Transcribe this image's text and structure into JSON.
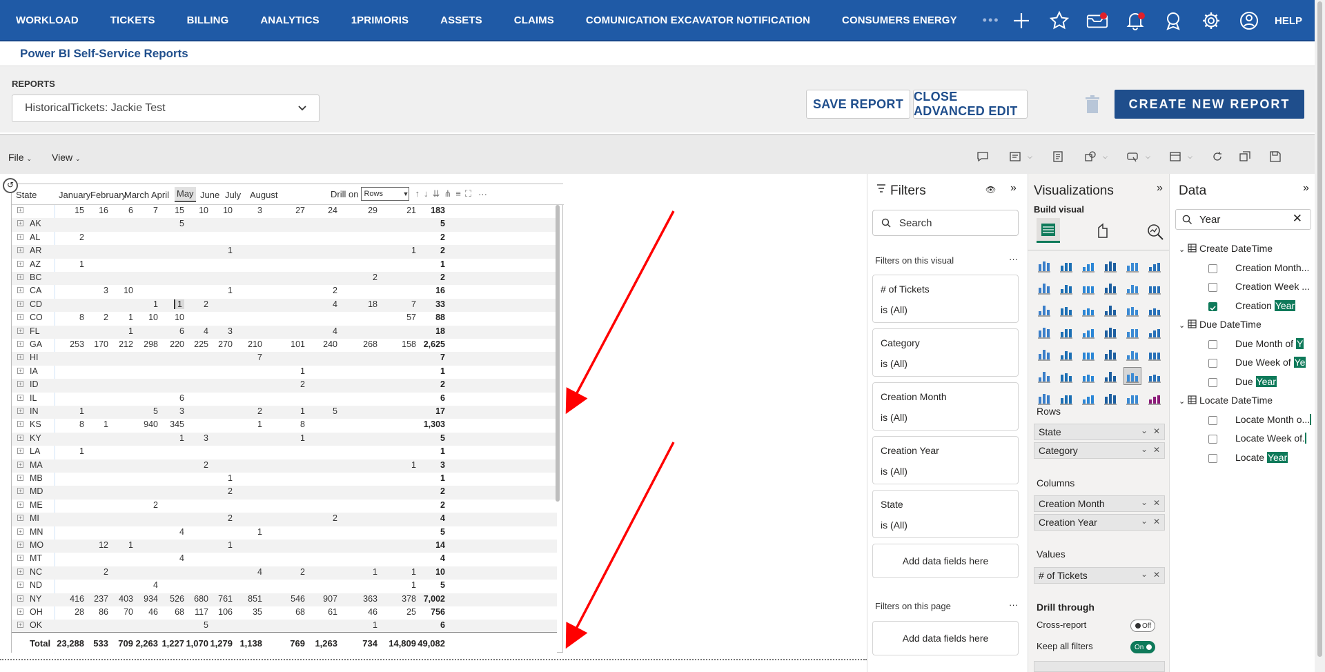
{
  "nav": {
    "items": [
      "WORKLOAD",
      "TICKETS",
      "BILLING",
      "ANALYTICS",
      "1PRIMORIS",
      "ASSETS",
      "CLAIMS",
      "COMUNICATION EXCAVATOR NOTIFICATION",
      "CONSUMERS ENERGY"
    ],
    "more": "•••",
    "help": "HELP"
  },
  "page": {
    "title": "Power BI Self-Service Reports",
    "reports_label": "REPORTS",
    "report_selected": "HistoricalTickets: Jackie Test",
    "save_label": "SAVE REPORT",
    "close_edit_label": "CLOSE ADVANCED EDIT",
    "create_label": "CREATE NEW REPORT"
  },
  "toolbar": {
    "file": "File",
    "view": "View"
  },
  "matrix": {
    "state_header": "State",
    "months": [
      "January",
      "February",
      "March",
      "April",
      "May",
      "June",
      "July",
      "August"
    ],
    "selected_month": "May",
    "drill_label": "Drill on",
    "drill_value": "Rows",
    "rows": [
      {
        "state": "",
        "v": [
          "15",
          "16",
          "6",
          "7",
          "15",
          "10",
          "10",
          "3",
          "27",
          "24",
          "29",
          "21"
        ],
        "t": "183"
      },
      {
        "state": "AK",
        "v": [
          "",
          "",
          "",
          "",
          "5",
          "",
          "",
          "",
          "",
          "",
          "",
          ""
        ],
        "t": "5"
      },
      {
        "state": "AL",
        "v": [
          "2",
          "",
          "",
          "",
          "",
          "",
          "",
          "",
          "",
          "",
          "",
          ""
        ],
        "t": "2"
      },
      {
        "state": "AR",
        "v": [
          "",
          "",
          "",
          "",
          "",
          "",
          "1",
          "",
          "",
          "",
          "",
          "1"
        ],
        "t": "2"
      },
      {
        "state": "AZ",
        "v": [
          "1",
          "",
          "",
          "",
          "",
          "",
          "",
          "",
          "",
          "",
          "",
          ""
        ],
        "t": "1"
      },
      {
        "state": "BC",
        "v": [
          "",
          "",
          "",
          "",
          "",
          "",
          "",
          "",
          "",
          "",
          "2",
          ""
        ],
        "t": "2"
      },
      {
        "state": "CA",
        "v": [
          "",
          "3",
          "10",
          "",
          "",
          "",
          "1",
          "",
          "",
          "2",
          "",
          ""
        ],
        "t": "16"
      },
      {
        "state": "CD",
        "v": [
          "",
          "",
          "",
          "1",
          "1",
          "2",
          "",
          "",
          "",
          "4",
          "18",
          "7"
        ],
        "t": "33"
      },
      {
        "state": "CO",
        "v": [
          "8",
          "2",
          "1",
          "10",
          "10",
          "",
          "",
          "",
          "",
          "",
          "",
          "57"
        ],
        "t": "88"
      },
      {
        "state": "FL",
        "v": [
          "",
          "",
          "1",
          "",
          "6",
          "4",
          "3",
          "",
          "",
          "4",
          "",
          ""
        ],
        "t": "18"
      },
      {
        "state": "GA",
        "v": [
          "253",
          "170",
          "212",
          "298",
          "220",
          "225",
          "270",
          "210",
          "101",
          "240",
          "268",
          "158"
        ],
        "t": "2,625"
      },
      {
        "state": "HI",
        "v": [
          "",
          "",
          "",
          "",
          "",
          "",
          "",
          "7",
          "",
          "",
          "",
          ""
        ],
        "t": "7"
      },
      {
        "state": "IA",
        "v": [
          "",
          "",
          "",
          "",
          "",
          "",
          "",
          "",
          "1",
          "",
          "",
          ""
        ],
        "t": "1"
      },
      {
        "state": "ID",
        "v": [
          "",
          "",
          "",
          "",
          "",
          "",
          "",
          "",
          "2",
          "",
          "",
          ""
        ],
        "t": "2"
      },
      {
        "state": "IL",
        "v": [
          "",
          "",
          "",
          "",
          "6",
          "",
          "",
          "",
          "",
          "",
          "",
          ""
        ],
        "t": "6"
      },
      {
        "state": "IN",
        "v": [
          "1",
          "",
          "",
          "5",
          "3",
          "",
          "",
          "2",
          "1",
          "5",
          "",
          ""
        ],
        "t": "17"
      },
      {
        "state": "KS",
        "v": [
          "8",
          "1",
          "",
          "940",
          "345",
          "",
          "",
          "1",
          "8",
          "",
          "",
          ""
        ],
        "t": "1,303"
      },
      {
        "state": "KY",
        "v": [
          "",
          "",
          "",
          "",
          "1",
          "3",
          "",
          "",
          "1",
          "",
          "",
          ""
        ],
        "t": "5"
      },
      {
        "state": "LA",
        "v": [
          "1",
          "",
          "",
          "",
          "",
          "",
          "",
          "",
          "",
          "",
          "",
          ""
        ],
        "t": "1"
      },
      {
        "state": "MA",
        "v": [
          "",
          "",
          "",
          "",
          "",
          "2",
          "",
          "",
          "",
          "",
          "",
          "1"
        ],
        "t": "3"
      },
      {
        "state": "MB",
        "v": [
          "",
          "",
          "",
          "",
          "",
          "",
          "1",
          "",
          "",
          "",
          "",
          ""
        ],
        "t": "1"
      },
      {
        "state": "MD",
        "v": [
          "",
          "",
          "",
          "",
          "",
          "",
          "2",
          "",
          "",
          "",
          "",
          ""
        ],
        "t": "2"
      },
      {
        "state": "ME",
        "v": [
          "",
          "",
          "",
          "2",
          "",
          "",
          "",
          "",
          "",
          "",
          "",
          ""
        ],
        "t": "2"
      },
      {
        "state": "MI",
        "v": [
          "",
          "",
          "",
          "",
          "",
          "",
          "2",
          "",
          "",
          "2",
          "",
          ""
        ],
        "t": "4"
      },
      {
        "state": "MN",
        "v": [
          "",
          "",
          "",
          "",
          "4",
          "",
          "",
          "1",
          "",
          "",
          "",
          ""
        ],
        "t": "5"
      },
      {
        "state": "MO",
        "v": [
          "",
          "12",
          "1",
          "",
          "",
          "",
          "1",
          "",
          "",
          "",
          "",
          ""
        ],
        "t": "14"
      },
      {
        "state": "MT",
        "v": [
          "",
          "",
          "",
          "",
          "4",
          "",
          "",
          "",
          "",
          "",
          "",
          ""
        ],
        "t": "4"
      },
      {
        "state": "NC",
        "v": [
          "",
          "2",
          "",
          "",
          "",
          "",
          "",
          "4",
          "2",
          "",
          "1",
          "1"
        ],
        "t": "10"
      },
      {
        "state": "ND",
        "v": [
          "",
          "",
          "",
          "4",
          "",
          "",
          "",
          "",
          "",
          "",
          "",
          "1"
        ],
        "t": "5"
      },
      {
        "state": "NY",
        "v": [
          "416",
          "237",
          "403",
          "934",
          "526",
          "680",
          "761",
          "851",
          "546",
          "907",
          "363",
          "378"
        ],
        "t": "7,002"
      },
      {
        "state": "OH",
        "v": [
          "28",
          "86",
          "70",
          "46",
          "68",
          "117",
          "106",
          "35",
          "68",
          "61",
          "46",
          "25"
        ],
        "t": "756"
      },
      {
        "state": "OK",
        "v": [
          "",
          "",
          "",
          "",
          "",
          "5",
          "",
          "",
          "",
          "",
          "1",
          ""
        ],
        "t": "6"
      }
    ],
    "total_label": "Total",
    "totals": [
      "23,288",
      "533",
      "709",
      "2,263",
      "1,227",
      "1,070",
      "1,279",
      "1,138",
      "769",
      "1,263",
      "734",
      "14,809"
    ],
    "grand_total": "49,082"
  },
  "filters": {
    "title": "Filters",
    "search_placeholder": "Search",
    "on_visual": "Filters on this visual",
    "cards": [
      {
        "title": "# of Tickets",
        "value": "is (All)"
      },
      {
        "title": "Category",
        "value": "is (All)"
      },
      {
        "title": "Creation Month",
        "value": "is (All)"
      },
      {
        "title": "Creation Year",
        "value": "is (All)"
      },
      {
        "title": "State",
        "value": "is (All)"
      }
    ],
    "add_fields": "Add data fields here",
    "on_page": "Filters on this page",
    "add_fields_page": "Add data fields here"
  },
  "viz": {
    "title": "Visualizations",
    "build_visual": "Build visual",
    "rows_label": "Rows",
    "rows": [
      "State",
      "Category"
    ],
    "columns_label": "Columns",
    "columns": [
      "Creation Month",
      "Creation Year"
    ],
    "values_label": "Values",
    "values": [
      "# of Tickets"
    ],
    "drill_through": "Drill through",
    "cross_report": "Cross-report",
    "cross_report_state": "Off",
    "keep_filters": "Keep all filters",
    "keep_filters_state": "On"
  },
  "data": {
    "title": "Data",
    "search_value": "Year",
    "tables": [
      {
        "name": "Create DateTime",
        "fields": [
          {
            "label": "Creation Month...",
            "checked": false
          },
          {
            "label": "Creation Week ...",
            "checked": false
          },
          {
            "label": "Creation ",
            "hl": "Year",
            "checked": true
          }
        ]
      },
      {
        "name": "Due DateTime",
        "fields": [
          {
            "label": "Due Month of ",
            "hl": "Y",
            "checked": false
          },
          {
            "label": "Due Week of ",
            "hl": "Ye",
            "checked": false
          },
          {
            "label": "Due ",
            "hl": "Year",
            "checked": false
          }
        ]
      },
      {
        "name": "Locate DateTime",
        "fields": [
          {
            "label": "Locate Month o...",
            "hl": "",
            "checked": false
          },
          {
            "label": "Locate Week of.",
            "hl": "",
            "checked": false
          },
          {
            "label": "Locate ",
            "hl": "Year",
            "checked": false
          }
        ]
      }
    ]
  },
  "colors": {
    "nav_bg": "#1f5aa6",
    "brand_blue": "#1f4e8c",
    "annotation_arrow": "#ff0000",
    "toggle_on": "#0f7a5a"
  }
}
